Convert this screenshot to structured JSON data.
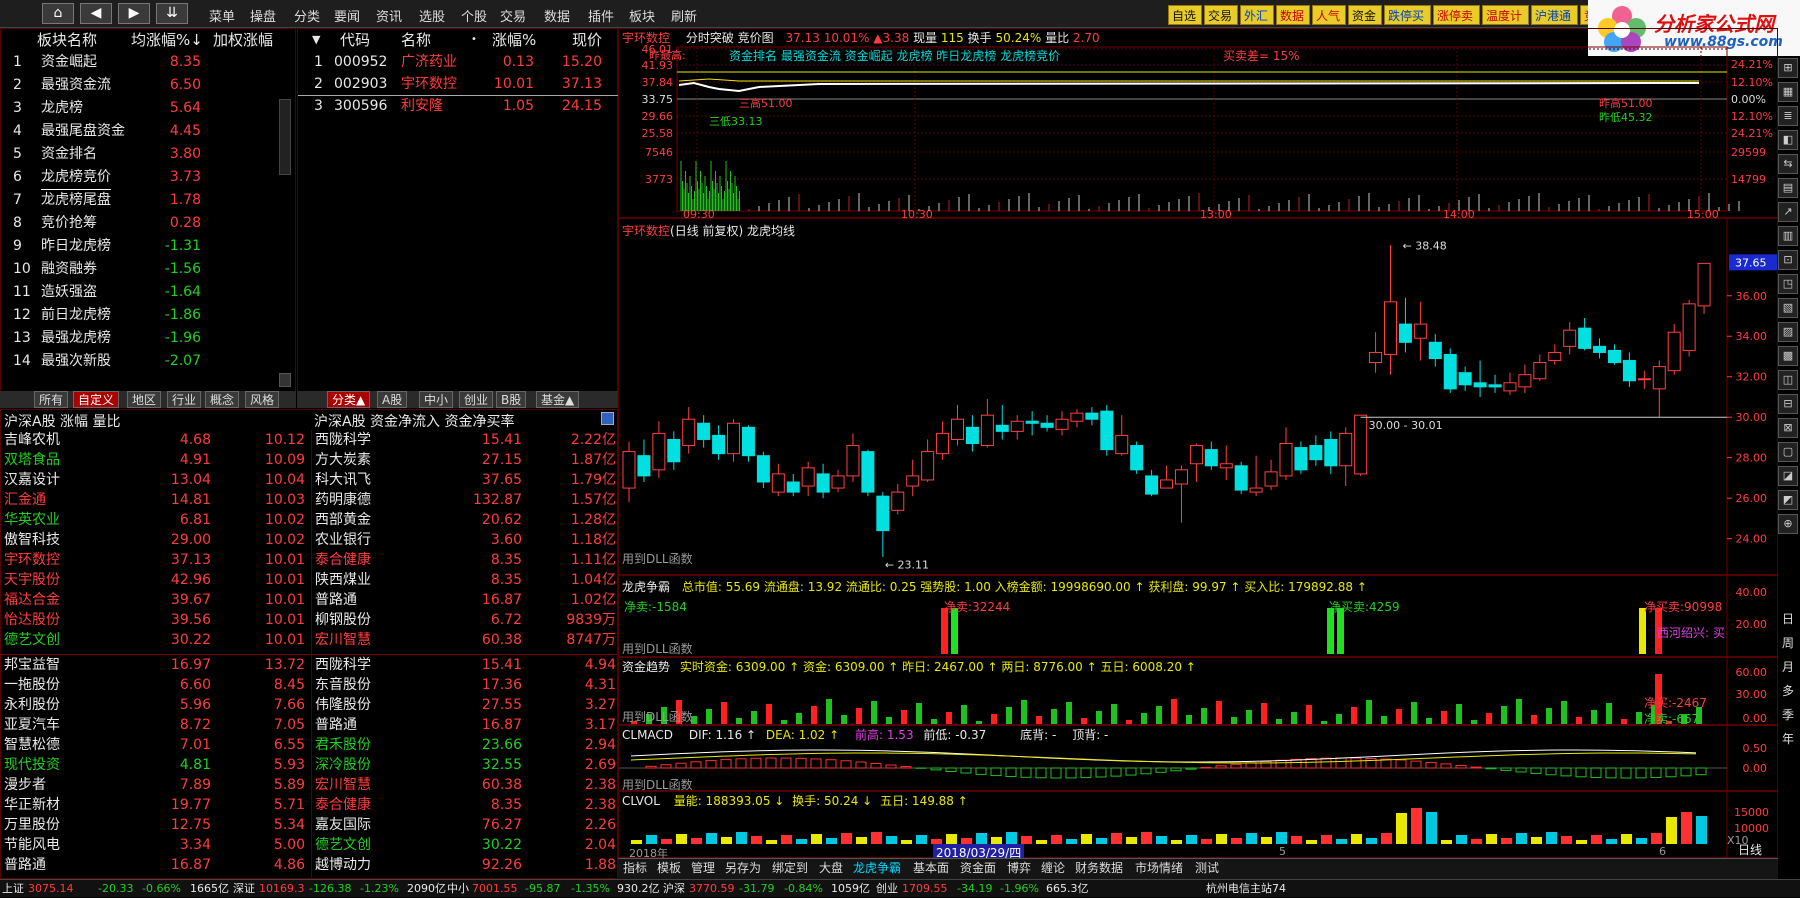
{
  "nav_buttons": [
    "⌂",
    "◀",
    "▶",
    "⇊"
  ],
  "menu": [
    "菜单",
    "操盘",
    "分类",
    "要闻",
    "资讯",
    "选股",
    "个股",
    "交易",
    "数据",
    "插件",
    "板块",
    "刷新"
  ],
  "right_buttons": [
    {
      "label": "自选",
      "style": "alt"
    },
    {
      "label": "交易",
      "style": "alt"
    },
    {
      "label": "外汇",
      "style": "blue"
    },
    {
      "label": "数据",
      "style": "red"
    },
    {
      "label": "人气",
      "style": "red"
    },
    {
      "label": "资金",
      "style": "alt"
    },
    {
      "label": "跌停买",
      "style": "blue"
    },
    {
      "label": "涨停卖",
      "style": "red"
    },
    {
      "label": "温度计",
      "style": "red"
    },
    {
      "label": "沪港通",
      "style": "blue"
    },
    {
      "label": "竞价池",
      "style": "red"
    }
  ],
  "logo": {
    "name": "分析家公式网",
    "url": "www.88gs.com"
  },
  "sectors": {
    "headers": [
      "板块名称",
      "均涨幅%↓",
      "加权涨幅"
    ],
    "rows": [
      {
        "n": "1",
        "name": "资金崛起",
        "v": "8.35"
      },
      {
        "n": "2",
        "name": "最强资金流",
        "v": "6.50"
      },
      {
        "n": "3",
        "name": "龙虎榜",
        "v": "5.64"
      },
      {
        "n": "4",
        "name": "最强尾盘资金",
        "v": "4.45"
      },
      {
        "n": "5",
        "name": "资金排名",
        "v": "3.80"
      },
      {
        "n": "6",
        "name": "龙虎榜竞价",
        "v": "3.73"
      },
      {
        "n": "7",
        "name": "龙虎榜尾盘",
        "v": "1.78"
      },
      {
        "n": "8",
        "name": "竞价抢筹",
        "v": "0.28"
      },
      {
        "n": "9",
        "name": "昨日龙虎榜",
        "v": "-1.31"
      },
      {
        "n": "10",
        "name": "融资融券",
        "v": "-1.56"
      },
      {
        "n": "11",
        "name": "造妖强盗",
        "v": "-1.64"
      },
      {
        "n": "12",
        "name": "前日龙虎榜",
        "v": "-1.86"
      },
      {
        "n": "13",
        "name": "最强龙虎榜",
        "v": "-1.96"
      },
      {
        "n": "14",
        "name": "最强次新股",
        "v": "-2.07"
      }
    ],
    "tabs": [
      "所有",
      "自定义",
      "地区",
      "行业",
      "概念",
      "风格"
    ]
  },
  "members": {
    "headers": [
      "代码",
      "名称",
      "涨幅%",
      "现价"
    ],
    "rows": [
      {
        "n": "1",
        "code": "000952",
        "name": "广济药业",
        "chg": "0.13",
        "price": "15.20"
      },
      {
        "n": "2",
        "code": "002903",
        "name": "宇环数控",
        "chg": "10.01",
        "price": "37.13"
      },
      {
        "n": "3",
        "code": "300596",
        "name": "利安隆",
        "chg": "1.05",
        "price": "24.15"
      }
    ],
    "tabs": [
      "分类▲",
      "A股",
      "中小",
      "创业",
      "B股",
      "基金▲"
    ]
  },
  "rank_left": {
    "header": "沪深A股 涨幅 量比",
    "rows": [
      {
        "name": "吉峰农机",
        "p": "4.68",
        "v": "10.12",
        "c": "w"
      },
      {
        "name": "双塔食品",
        "p": "4.91",
        "v": "10.09",
        "c": "g"
      },
      {
        "name": "汉嘉设计",
        "p": "13.04",
        "v": "10.04",
        "c": "w"
      },
      {
        "name": "汇金通",
        "p": "14.81",
        "v": "10.03",
        "c": "r"
      },
      {
        "name": "华英农业",
        "p": "6.81",
        "v": "10.02",
        "c": "g"
      },
      {
        "name": "傲智科技",
        "p": "29.00",
        "v": "10.02",
        "c": "w"
      },
      {
        "name": "宇环数控",
        "p": "37.13",
        "v": "10.01",
        "c": "r"
      },
      {
        "name": "天宇股份",
        "p": "42.96",
        "v": "10.01",
        "c": "r"
      },
      {
        "name": "福达合金",
        "p": "39.67",
        "v": "10.01",
        "c": "r"
      },
      {
        "name": "怡达股份",
        "p": "39.56",
        "v": "10.01",
        "c": "r"
      },
      {
        "name": "德艺文创",
        "p": "30.22",
        "v": "10.01",
        "c": "g"
      },
      {
        "name": "邦宝益智",
        "p": "16.97",
        "v": "13.72",
        "c": "w"
      },
      {
        "name": "一拖股份",
        "p": "6.60",
        "v": "8.45",
        "c": "w"
      },
      {
        "name": "永利股份",
        "p": "5.96",
        "v": "7.66",
        "c": "w"
      },
      {
        "name": "亚夏汽车",
        "p": "8.72",
        "v": "7.05",
        "c": "w"
      },
      {
        "name": "智慧松德",
        "p": "7.01",
        "v": "6.55",
        "c": "w"
      },
      {
        "name": "现代投资",
        "p": "4.81",
        "v": "5.93",
        "c": "g"
      },
      {
        "name": "漫步者",
        "p": "7.89",
        "v": "5.89",
        "c": "w"
      },
      {
        "name": "华正新材",
        "p": "19.77",
        "v": "5.71",
        "c": "w"
      },
      {
        "name": "万里股份",
        "p": "12.75",
        "v": "5.34",
        "c": "w"
      },
      {
        "name": "节能风电",
        "p": "3.34",
        "v": "5.00",
        "c": "w"
      },
      {
        "name": "普路通",
        "p": "16.87",
        "v": "4.86",
        "c": "w"
      }
    ]
  },
  "rank_right": {
    "header": "沪深A股 资金净流入 资金净买率",
    "rows": [
      {
        "name": "西陇科学",
        "p": "15.41",
        "v": "2.22亿",
        "c": "w"
      },
      {
        "name": "方大炭素",
        "p": "27.15",
        "v": "1.87亿",
        "c": "w"
      },
      {
        "name": "科大讯飞",
        "p": "37.65",
        "v": "1.79亿",
        "c": "w"
      },
      {
        "name": "药明康德",
        "p": "132.87",
        "v": "1.57亿",
        "c": "w"
      },
      {
        "name": "西部黄金",
        "p": "20.62",
        "v": "1.28亿",
        "c": "w"
      },
      {
        "name": "农业银行",
        "p": "3.60",
        "v": "1.18亿",
        "c": "w"
      },
      {
        "name": "泰合健康",
        "p": "8.35",
        "v": "1.11亿",
        "c": "r"
      },
      {
        "name": "陕西煤业",
        "p": "8.35",
        "v": "1.04亿",
        "c": "w"
      },
      {
        "name": "普路通",
        "p": "16.87",
        "v": "1.02亿",
        "c": "w"
      },
      {
        "name": "柳钢股份",
        "p": "6.72",
        "v": "9839万",
        "c": "w"
      },
      {
        "name": "宏川智慧",
        "p": "60.38",
        "v": "8747万",
        "c": "r"
      },
      {
        "name": "西陇科学",
        "p": "15.41",
        "v": "4.94",
        "c": "w"
      },
      {
        "name": "东音股份",
        "p": "17.36",
        "v": "4.31",
        "c": "w"
      },
      {
        "name": "伟隆股份",
        "p": "27.55",
        "v": "3.27",
        "c": "w"
      },
      {
        "name": "普路通",
        "p": "16.87",
        "v": "3.17",
        "c": "w"
      },
      {
        "name": "君禾股份",
        "p": "23.66",
        "v": "2.94",
        "c": "g"
      },
      {
        "name": "深冷股份",
        "p": "32.55",
        "v": "2.69",
        "c": "g"
      },
      {
        "name": "宏川智慧",
        "p": "60.38",
        "v": "2.38",
        "c": "r"
      },
      {
        "name": "泰合健康",
        "p": "8.35",
        "v": "2.38",
        "c": "r"
      },
      {
        "name": "嘉友国际",
        "p": "76.27",
        "v": "2.26",
        "c": "w"
      },
      {
        "name": "德艺文创",
        "p": "30.22",
        "v": "2.04",
        "c": "g"
      },
      {
        "name": "越博动力",
        "p": "92.26",
        "v": "1.88",
        "c": "w"
      }
    ]
  },
  "intraday": {
    "stock": "宇环数控",
    "title": "分时突破 竞价图",
    "price": "37.13",
    "pct": "10.01%",
    "delta": "▲3.38",
    "vol_label": "现量",
    "vol": "115",
    "turn_label": "换手",
    "turn": "50.24%",
    "lb_label": "量比",
    "lb": "2.70",
    "legend": "资金排名 最强资金流 资金崛起 龙虎榜 昨日龙虎榜 龙虎榜竞价",
    "sell_note": "买卖差= 15%",
    "left_axis": [
      "46.01",
      "41.93",
      "37.84",
      "33.75",
      "29.66",
      "25.58",
      "7546",
      "3773"
    ],
    "right_axis": [
      "24.21%",
      "12.10%",
      "0.00%",
      "12.10%",
      "24.21%",
      "29599",
      "14799"
    ],
    "times": [
      "09:30",
      "10:30",
      "13:00",
      "14:00",
      "15:00"
    ],
    "annots": [
      "昨最高:",
      "三高51.00",
      "三低33.13",
      "昨高51.00",
      "昨低45.32"
    ]
  },
  "kline": {
    "title_stock": "宇环数控",
    "title_rest": "(日线 前复权) 龙虎均线",
    "last_price": "37.65",
    "hi_label": "38.48",
    "lo_label": "23.11",
    "range_label": "30.00 - 30.01",
    "dll": "用到DLL函数",
    "yaxis": [
      "36.00",
      "34.00",
      "32.00",
      "30.00",
      "28.00",
      "26.00",
      "24.00"
    ],
    "candles": [
      [
        26.5,
        28.3,
        25.8,
        28.8
      ],
      [
        28.1,
        27.1,
        26.8,
        28.9
      ],
      [
        27.4,
        29.2,
        27,
        29.8
      ],
      [
        28.9,
        27.8,
        27.4,
        29.3
      ],
      [
        28.6,
        29.9,
        28.2,
        30.5
      ],
      [
        29.7,
        28.9,
        28.5,
        30.1
      ],
      [
        29.1,
        28.2,
        27.9,
        29.6
      ],
      [
        28.2,
        29.7,
        27.8,
        29.9
      ],
      [
        29.5,
        28.1,
        27.8,
        29.6
      ],
      [
        28.1,
        26.8,
        26.5,
        28.3
      ],
      [
        26.3,
        27.2,
        26.1,
        27.7
      ],
      [
        26.8,
        26.3,
        26.1,
        27.2
      ],
      [
        26.6,
        27.5,
        26.1,
        27.8
      ],
      [
        27.2,
        26.3,
        26,
        27.7
      ],
      [
        26.5,
        27.1,
        26.3,
        27.4
      ],
      [
        27.1,
        28.6,
        26.8,
        29.2
      ],
      [
        28.3,
        26.3,
        26.1,
        28.4
      ],
      [
        26.1,
        24.4,
        23.1,
        26.3
      ],
      [
        25.4,
        26.3,
        25.2,
        26.7
      ],
      [
        26.6,
        27.1,
        26.1,
        27.9
      ],
      [
        26.9,
        28.3,
        26.8,
        28.9
      ],
      [
        28.2,
        29.2,
        27.9,
        29.8
      ],
      [
        28.9,
        29.9,
        28.6,
        30.6
      ],
      [
        29.5,
        28.7,
        28.3,
        30.1
      ],
      [
        28.6,
        30.1,
        28.5,
        30.9
      ],
      [
        29.6,
        29.3,
        28.9,
        30.6
      ],
      [
        29.3,
        29.8,
        28.9,
        30.1
      ],
      [
        29.8,
        29.7,
        29.1,
        30.3
      ],
      [
        29.7,
        29.5,
        29.3,
        30.1
      ],
      [
        29.4,
        29.9,
        29.1,
        30.3
      ],
      [
        29.8,
        30.2,
        29.5,
        30.4
      ],
      [
        30.2,
        29.9,
        29.6,
        30.5
      ],
      [
        30.3,
        28.4,
        28.1,
        30.6
      ],
      [
        28.2,
        29.1,
        28.1,
        30.1
      ],
      [
        28.6,
        27.4,
        27.2,
        28.8
      ],
      [
        27.1,
        26.2,
        26.1,
        27.4
      ],
      [
        26.5,
        26.9,
        26.5,
        27.6
      ],
      [
        26.7,
        27.4,
        24.8,
        27.6
      ],
      [
        27.7,
        28.6,
        26.8,
        28.7
      ],
      [
        28.4,
        27.6,
        27.4,
        28.8
      ],
      [
        27.5,
        27.7,
        26.9,
        28.6
      ],
      [
        27.6,
        26.4,
        26.2,
        27.8
      ],
      [
        26.3,
        26.5,
        26.1,
        28.1
      ],
      [
        26.6,
        27.3,
        26.4,
        27.9
      ],
      [
        27.1,
        28.7,
        26.9,
        29.5
      ],
      [
        28.5,
        27.4,
        27.2,
        28.8
      ],
      [
        28.6,
        27.9,
        27.6,
        29.1
      ],
      [
        28.9,
        27.6,
        27.2,
        29.3
      ],
      [
        27.6,
        29.2,
        26.6,
        29.5
      ],
      [
        27.2,
        30.1,
        27.1,
        30.1
      ],
      [
        32.7,
        33.2,
        32.2,
        34.2
      ],
      [
        33.1,
        35.7,
        32.1,
        38.5
      ],
      [
        34.6,
        33.7,
        33.2,
        35.9
      ],
      [
        33.9,
        34.6,
        32.8,
        35.7
      ],
      [
        33.7,
        32.9,
        32.5,
        34.1
      ],
      [
        33.1,
        31.4,
        31.2,
        33.4
      ],
      [
        32.2,
        31.6,
        31.3,
        32.5
      ],
      [
        31.7,
        31.5,
        31,
        32.8
      ],
      [
        31.6,
        31.5,
        31.2,
        32.1
      ],
      [
        31.3,
        31.7,
        31.1,
        32.2
      ],
      [
        31.5,
        32.1,
        31.2,
        32.6
      ],
      [
        31.9,
        32.7,
        31.8,
        33.1
      ],
      [
        32.8,
        33.2,
        32.6,
        33.6
      ],
      [
        33.5,
        34.3,
        33.1,
        34.7
      ],
      [
        34.4,
        33.4,
        33.3,
        34.9
      ],
      [
        33.5,
        33.2,
        32.9,
        33.9
      ],
      [
        33.3,
        32.7,
        32.6,
        33.6
      ],
      [
        32.8,
        31.8,
        31.5,
        33.2
      ],
      [
        31.9,
        31.9,
        31.4,
        32.3
      ],
      [
        31.4,
        32.5,
        30,
        32.8
      ],
      [
        32.3,
        34.2,
        32.1,
        34.6
      ],
      [
        33.3,
        35.6,
        33,
        35.8
      ],
      [
        35.5,
        37.6,
        35.1,
        37.6
      ]
    ]
  },
  "lhzb": {
    "title": "龙虎争霸",
    "stats": "总市值: 55.69  流通盘: 13.92  流通比: 0.25  强势股: 1.00  入榜金额: 19998690.00 ↑  获利盘: 99.97 ↑  买入比: 179892.88 ↑",
    "sell": "净卖:-1584",
    "mid1": "净卖:32244",
    "mid2": "净买卖:4259",
    "end": "净买卖:90998",
    "note": "西河绍兴: 买",
    "yaxis": [
      "40.00",
      "20.00"
    ],
    "dll": "用到DLL函数"
  },
  "zjqs": {
    "title": "资金趋势",
    "items": "实时资金: 6309.00 ↑  资金: 6309.00 ↑  昨日: 2467.00 ↑  两日: 8776.00 ↑  五日: 6008.20 ↑",
    "buy": "净买:-2467",
    "sell": "净卖:-667",
    "yaxis": [
      "60.00",
      "30.00",
      "0.00"
    ],
    "dll": "用到DLL函数"
  },
  "clmacd": {
    "title": "CLMACD",
    "dif": "DIF: 1.16 ↑",
    "dea": "DEA: 1.02 ↑",
    "high": "前高: 1.53",
    "low": "前低: -0.37",
    "bottom": "底背: -",
    "top": "顶背: -",
    "yaxis": [
      "0.50",
      "0.00"
    ],
    "dll": "用到DLL函数"
  },
  "clvol": {
    "title": "CLVOL",
    "vol": "量能: 188393.05 ↓",
    "turn": "换手: 50.24 ↓",
    "five": "五日: 149.88 ↑",
    "yaxis": [
      "15000",
      "10000"
    ],
    "x10": "X10"
  },
  "date_labels": {
    "year": "2018年",
    "date": "2018/03/29/四",
    "m5": "5",
    "m6": "6"
  },
  "bottom_tabs": [
    "指标",
    "模板",
    "管理",
    "另存为",
    "绑定到",
    "大盘",
    "龙虎争霸",
    "基本面",
    "资金面",
    "博弈",
    "缠论",
    "财务数据",
    "市场情绪",
    "测试"
  ],
  "period": "日线",
  "vtabs": [
    "日",
    "周",
    "月",
    "多",
    "季",
    "年"
  ],
  "status": {
    "sh": "上证",
    "sh_idx": "3075.14",
    "sh_ch": "-20.33",
    "sh_pct": "-0.66%",
    "sh_amt": "1665亿",
    "sz": "深证",
    "sz_idx": "10169.3",
    "sz_ch": "-126.38",
    "sz_pct": "-1.23%",
    "sz_amt": "2090亿",
    "zx": "中小",
    "zx_idx": "7001.55",
    "zx_ch": "-95.87",
    "zx_pct": "-1.35%",
    "zx_amt": "930.2亿",
    "hs": "沪深",
    "hs_idx": "3770.59",
    "hs_ch": "-31.79",
    "hs_pct": "-0.84%",
    "hs_amt": "1059亿",
    "cy": "创业",
    "cy_idx": "1709.55",
    "cy_ch": "-34.19",
    "cy_pct": "-1.96%",
    "cy_amt": "665.3亿",
    "server": "杭州电信主站74"
  }
}
